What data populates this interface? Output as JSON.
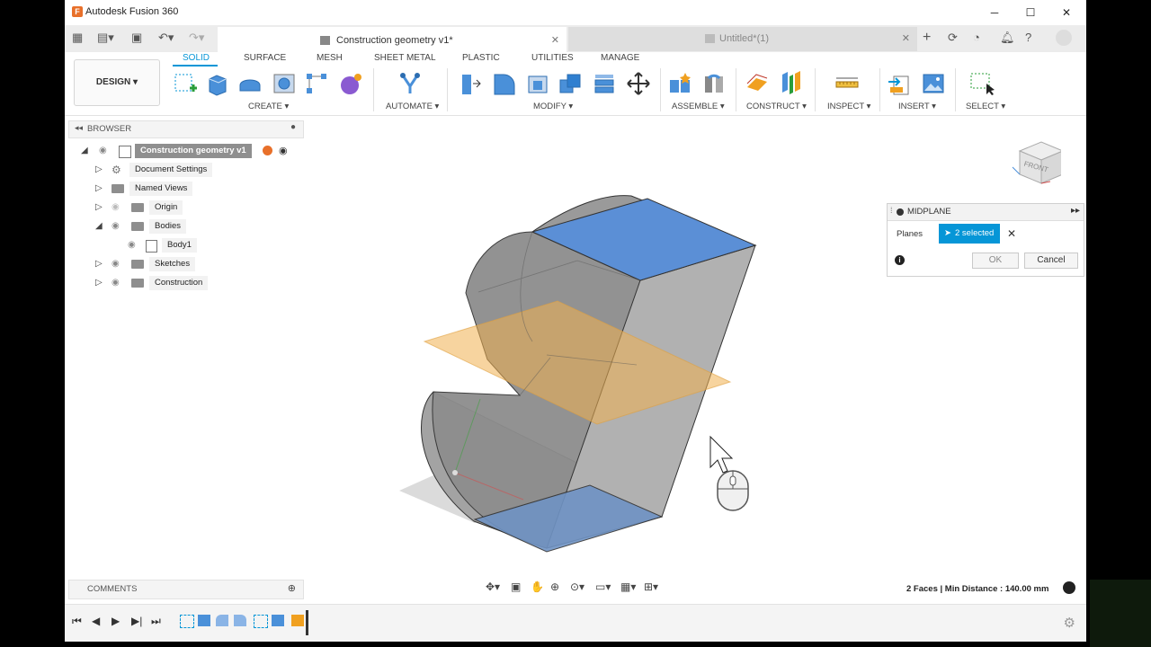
{
  "window": {
    "title": "Autodesk Fusion 360",
    "minimize": "─",
    "maximize": "☐",
    "close": "✕"
  },
  "tabs": [
    {
      "label": "Construction geometry v1*",
      "close": "✕"
    },
    {
      "label": "Untitled*(1)",
      "close": "✕"
    }
  ],
  "workspace": {
    "label": "DESIGN ▾"
  },
  "ribbon_tabs": [
    "SOLID",
    "SURFACE",
    "MESH",
    "SHEET METAL",
    "PLASTIC",
    "UTILITIES",
    "MANAGE"
  ],
  "ribbon_groups": [
    "CREATE ▾",
    "AUTOMATE ▾",
    "MODIFY ▾",
    "ASSEMBLE ▾",
    "CONSTRUCT ▾",
    "INSPECT ▾",
    "INSERT ▾",
    "SELECT ▾"
  ],
  "browser": {
    "title": "BROWSER",
    "root": "Construction geometry v1",
    "items": [
      "Document Settings",
      "Named Views",
      "Origin",
      "Bodies",
      "Body1",
      "Sketches",
      "Construction"
    ]
  },
  "comments": {
    "title": "COMMENTS"
  },
  "midplane": {
    "title": "MIDPLANE",
    "planes_label": "Planes",
    "selected": "2 selected",
    "ok": "OK",
    "cancel": "Cancel"
  },
  "viewcube": {
    "label": "FRONT"
  },
  "status": {
    "text": "2 Faces | Min Distance : 140.00 mm"
  },
  "colors": {
    "accent": "#0696d7",
    "selected_face": "#5b8fd6",
    "plane": "#f0b050"
  }
}
